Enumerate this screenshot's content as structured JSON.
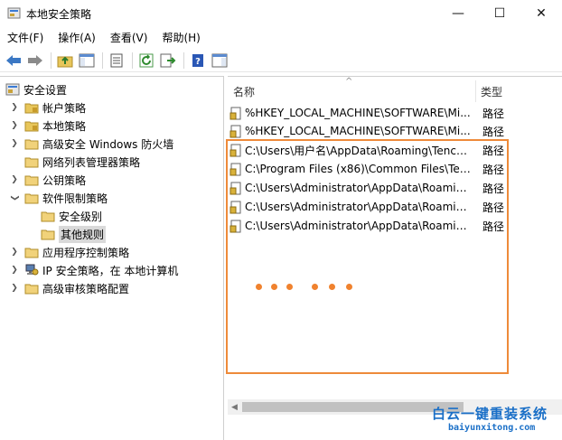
{
  "window": {
    "title": "本地安全策略",
    "minimize_glyph": "—",
    "maximize_glyph": "☐",
    "close_glyph": "✕"
  },
  "menu": [
    "文件(F)",
    "操作(A)",
    "查看(V)",
    "帮助(H)"
  ],
  "toolbar": {
    "buttons": [
      "back-arrow-icon",
      "forward-arrow-icon",
      "up-folder-icon",
      "show-tree-icon",
      "properties-icon",
      "refresh-icon",
      "export-list-icon",
      "help-icon",
      "action-pane-icon"
    ]
  },
  "tree": {
    "root": "安全设置",
    "items": [
      {
        "label": "帐户策略",
        "expander": "right"
      },
      {
        "label": "本地策略",
        "expander": "right"
      },
      {
        "label": "高级安全 Windows 防火墙",
        "expander": "right"
      },
      {
        "label": "网络列表管理器策略",
        "expander": "none"
      },
      {
        "label": "公钥策略",
        "expander": "right"
      },
      {
        "label": "软件限制策略",
        "expander": "down"
      },
      {
        "label": "安全级别",
        "expander": "none",
        "child": true
      },
      {
        "label": "其他规则",
        "expander": "none",
        "child": true,
        "selected": true
      },
      {
        "label": "应用程序控制策略",
        "expander": "right"
      },
      {
        "label": "IP 安全策略，在 本地计算机",
        "expander": "right"
      },
      {
        "label": "高级审核策略配置",
        "expander": "right"
      }
    ]
  },
  "list": {
    "columns": {
      "name": "名称",
      "type": "类型"
    },
    "rows": [
      {
        "name": "%HKEY_LOCAL_MACHINE\\SOFTWARE\\Mi...",
        "type": "路径"
      },
      {
        "name": "%HKEY_LOCAL_MACHINE\\SOFTWARE\\Mi...",
        "type": "路径"
      },
      {
        "name": "C:\\Users\\用户名\\AppData\\Roaming\\Tence...",
        "type": "路径"
      },
      {
        "name": "C:\\Program Files (x86)\\Common Files\\Ten...",
        "type": "路径"
      },
      {
        "name": "C:\\Users\\Administrator\\AppData\\Roamin...",
        "type": "路径"
      },
      {
        "name": "C:\\Users\\Administrator\\AppData\\Roamin...",
        "type": "路径"
      },
      {
        "name": "C:\\Users\\Administrator\\AppData\\Roamin...",
        "type": "路径"
      }
    ]
  },
  "annotation": {
    "color": "#ee8a3a",
    "dots": 6
  },
  "watermark": {
    "title": "白云一键重装系统",
    "url": "baiyunxitong.com"
  }
}
